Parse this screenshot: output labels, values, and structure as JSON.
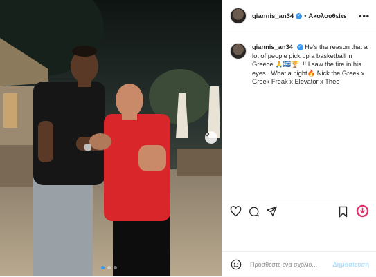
{
  "header": {
    "username": "giannis_an34",
    "separator": "•",
    "follow_label": "Ακολουθείτε",
    "more_label": "•••"
  },
  "caption": {
    "username": "giannis_an34",
    "text": "He's the reason that a lot of people pick up a basketball in Greece 🙏🇬🇷🏆..!! I saw the fire in his eyes.. What a night🔥 Nick the Greek x Greek Freak x Elevator x Theo"
  },
  "photo": {
    "carousel_current": 1,
    "carousel_total": 3
  },
  "actions": {
    "like_icon": "heart-icon",
    "comment_icon": "comment-icon",
    "share_icon": "share-icon",
    "save_icon": "bookmark-icon"
  },
  "comment_box": {
    "placeholder": "Προσθέστε ένα σχόλιο...",
    "post_label": "Δημοσίευση"
  },
  "colors": {
    "verified": "#3897f0",
    "post_button": "#b2dffc",
    "shirt_red": "#d8262b"
  }
}
